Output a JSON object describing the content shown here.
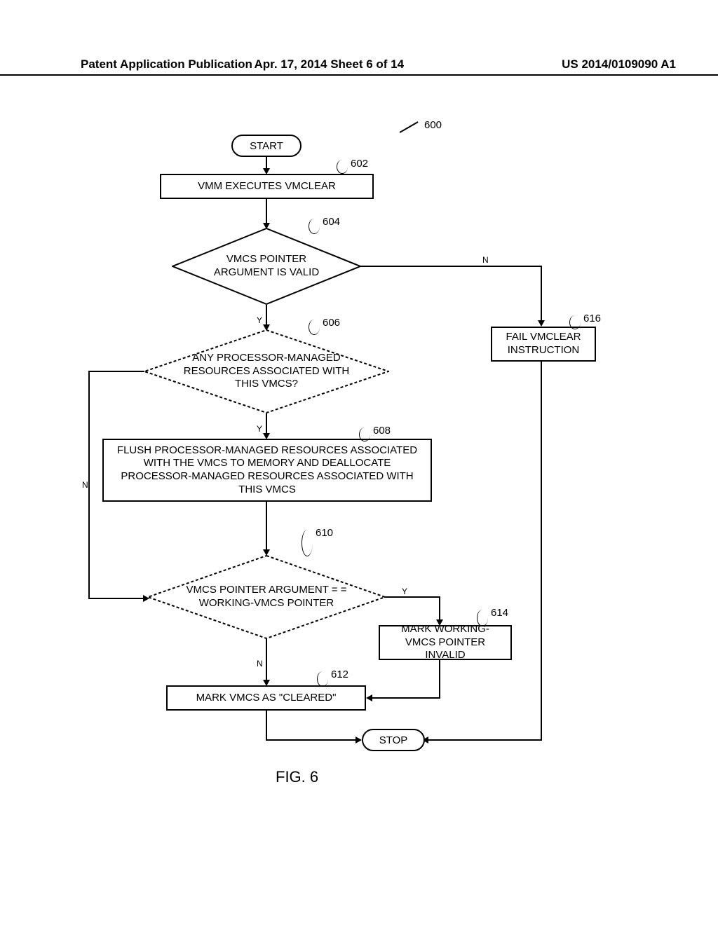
{
  "header": {
    "left": "Patent Application Publication",
    "center": "Apr. 17, 2014  Sheet 6 of 14",
    "right": "US 2014/0109090 A1"
  },
  "flowchart": {
    "ref600": "600",
    "start": "START",
    "n602": {
      "ref": "602",
      "text": "VMM EXECUTES VMCLEAR"
    },
    "n604": {
      "ref": "604",
      "text": "VMCS POINTER ARGUMENT IS VALID"
    },
    "n606": {
      "ref": "606",
      "text": "ANY PROCESSOR-MANAGED RESOURCES ASSOCIATED WITH THIS VMCS?"
    },
    "n616": {
      "ref": "616",
      "text": "FAIL VMCLEAR INSTRUCTION"
    },
    "n608": {
      "ref": "608",
      "text": "FLUSH PROCESSOR-MANAGED RESOURCES ASSOCIATED WITH THE VMCS TO MEMORY AND DEALLOCATE PROCESSOR-MANAGED RESOURCES ASSOCIATED WITH THIS VMCS"
    },
    "n610": {
      "ref": "610",
      "text": "VMCS POINTER ARGUMENT = = WORKING-VMCS POINTER"
    },
    "n614": {
      "ref": "614",
      "text": "MARK WORKING-VMCS POINTER INVALID"
    },
    "n612": {
      "ref": "612",
      "text": "MARK VMCS AS \"CLEARED\""
    },
    "stop": "STOP",
    "labels": {
      "Y": "Y",
      "N": "N"
    }
  },
  "figure_caption": "FIG. 6"
}
